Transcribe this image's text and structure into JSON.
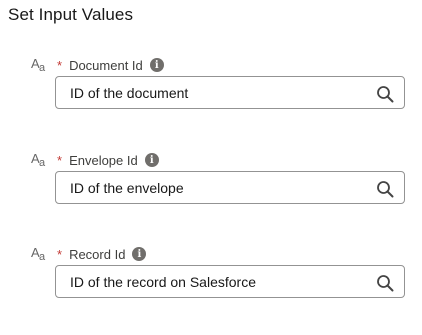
{
  "section": {
    "title": "Set Input Values"
  },
  "fields": [
    {
      "type_icon": "text-type-icon",
      "required_mark": "*",
      "label": "Document Id",
      "info_icon": "info-icon",
      "value": "ID of the document",
      "action_icon": "search-icon"
    },
    {
      "type_icon": "text-type-icon",
      "required_mark": "*",
      "label": "Envelope Id",
      "info_icon": "info-icon",
      "value": "ID of the envelope",
      "action_icon": "search-icon"
    },
    {
      "type_icon": "text-type-icon",
      "required_mark": "*",
      "label": "Record Id",
      "info_icon": "info-icon",
      "value": "ID of the record on Salesforce",
      "action_icon": "search-icon"
    }
  ]
}
